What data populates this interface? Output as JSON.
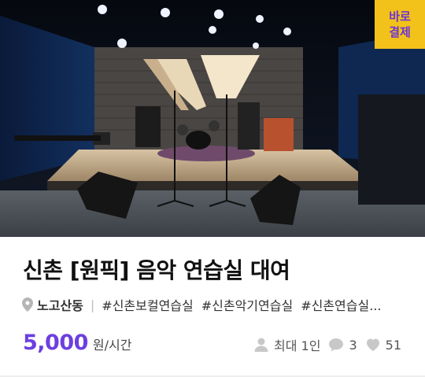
{
  "card": {
    "badge": [
      "바로",
      "결제"
    ],
    "title": "신촌 [원픽] 음악 연습실 대여",
    "location": "노고산동",
    "separator": "|",
    "tags": [
      "#신촌보컬연습실",
      "#신촌악기연습실",
      "#신촌연습실..."
    ],
    "price": "5,000",
    "price_unit": "원/시간",
    "max_people": "최대 1인",
    "comments": "3",
    "likes": "51"
  },
  "icons": {
    "location": "map-pin-icon",
    "people": "person-icon",
    "comments": "speech-bubble-icon",
    "likes": "heart-icon"
  },
  "colors": {
    "accent": "#6c3fe0",
    "badge_bg": "#f3c21a",
    "badge_text": "#6b34d6",
    "icon_gray": "#c8c8c8"
  }
}
